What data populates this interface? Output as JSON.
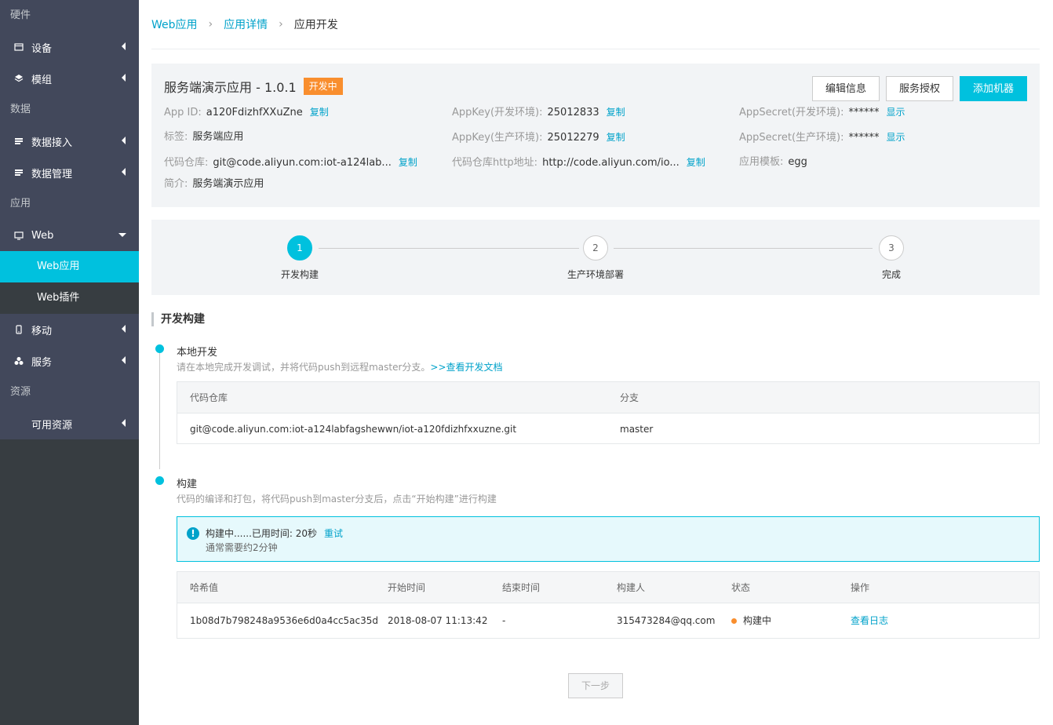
{
  "sidebar": {
    "sec_hardware": "硬件",
    "device": "设备",
    "module": "模组",
    "sec_data": "数据",
    "data_access": "数据接入",
    "data_manage": "数据管理",
    "sec_app": "应用",
    "web": "Web",
    "web_app": "Web应用",
    "web_plugin": "Web插件",
    "mobile": "移动",
    "service": "服务",
    "sec_resource": "资源",
    "available": "可用资源"
  },
  "breadcrumb": {
    "c1": "Web应用",
    "c2": "应用详情",
    "c3": "应用开发",
    "sep": "›"
  },
  "app": {
    "name": "服务端演示应用 - 1.0.1",
    "status": "开发中",
    "btn_edit": "编辑信息",
    "btn_auth": "服务授权",
    "btn_add": "添加机器",
    "appid_k": "App ID:",
    "appid_v": "a120FdizhfXXuZne",
    "copy": "复制",
    "show": "显示",
    "tag_k": "标签:",
    "tag_v": "服务端应用",
    "repo_k": "代码仓库:",
    "repo_v": "git@code.aliyun.com:iot-a124lab...",
    "desc_k": "简介:",
    "desc_v": "服务端演示应用",
    "key_dev_k": "AppKey(开发环境):",
    "key_dev_v": "25012833",
    "key_prod_k": "AppKey(生产环境):",
    "key_prod_v": "25012279",
    "http_k": "代码仓库http地址:",
    "http_v": "http://code.aliyun.com/io...",
    "sec_dev_k": "AppSecret(开发环境):",
    "sec_dev_v": "******",
    "sec_prod_k": "AppSecret(生产环境):",
    "sec_prod_v": "******",
    "tpl_k": "应用模板:",
    "tpl_v": "egg"
  },
  "steps": [
    {
      "num": "1",
      "label": "开发构建"
    },
    {
      "num": "2",
      "label": "生产环境部署"
    },
    {
      "num": "3",
      "label": "完成"
    }
  ],
  "section_title": "开发构建",
  "local": {
    "title": "本地开发",
    "desc": "请在本地完成开发调试，并将代码push到远程master分支。",
    "doc_link": ">>查看开发文档",
    "th_repo": "代码仓库",
    "th_branch": "分支",
    "repo": "git@code.aliyun.com:iot-a124labfagshewwn/iot-a120fdizhfxxuzne.git",
    "branch": "master"
  },
  "build": {
    "title": "构建",
    "desc": "代码的编译和打包，将代码push到master分支后，点击“开始构建”进行构建",
    "alert_icon": "!",
    "alert_text": "构建中......已用时间: 20秒",
    "retry": "重试",
    "alert_sub": "通常需要约2分钟",
    "headers": [
      "哈希值",
      "开始时间",
      "结束时间",
      "构建人",
      "状态",
      "操作"
    ],
    "row": {
      "hash": "1b08d7b798248a9536e6d0a4cc5ac35d",
      "start": "2018-08-07 11:13:42",
      "end": "-",
      "user": "315473284@qq.com",
      "status": "构建中",
      "action": "查看日志"
    }
  },
  "next_btn": "下一步",
  "colors": {
    "accent": "#00c1de",
    "link": "#00a2ca",
    "badge": "#f98e2e",
    "sidebar": "#373d41"
  }
}
